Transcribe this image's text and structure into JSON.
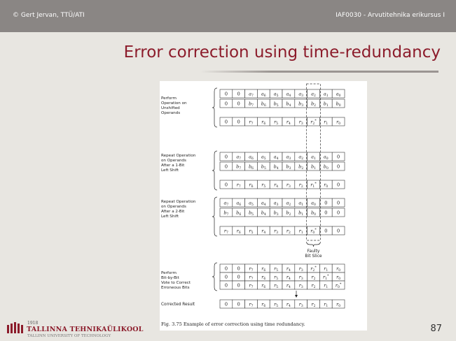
{
  "header": {
    "left": "© Gert Jervan, TTÜ/ATI",
    "right": "IAF0030 - Arvutitehnika erikursus I"
  },
  "slide": {
    "title": "Error correction using time-redundancy",
    "page_number": "87"
  },
  "logo": {
    "year": "1918",
    "name": "TALLINNA TEHNIKAÜLIKOOL",
    "sub": "TALLINN UNIVERSITY OF TECHNOLOGY"
  },
  "figure": {
    "caption": "Fig. 3.75 Example of error correction using time redundancy.",
    "faulty_label_1": "Faulty",
    "faulty_label_2": "Bit Slice",
    "groups": [
      {
        "label": [
          "Perform",
          "Operation on",
          "Unshifted",
          "Operands"
        ],
        "rows": [
          [
            "0",
            "0",
            "a7",
            "a6",
            "a5",
            "a4",
            "a3",
            "a2",
            "a1",
            "a0"
          ],
          [
            "0",
            "0",
            "b7",
            "b6",
            "b5",
            "b4",
            "b3",
            "b2",
            "b1",
            "b0"
          ],
          [
            "0",
            "0",
            "r7",
            "r6",
            "r5",
            "r4",
            "r3",
            "r2*",
            "r1",
            "r0"
          ]
        ]
      },
      {
        "label": [
          "Repeat Operation",
          "on Operands",
          "After a 1-Bit",
          "Left Shift"
        ],
        "rows": [
          [
            "0",
            "a7",
            "a6",
            "a5",
            "a4",
            "a3",
            "a2",
            "a1",
            "a0",
            "0"
          ],
          [
            "0",
            "b7",
            "b6",
            "b5",
            "b4",
            "b3",
            "b2",
            "b1",
            "b0",
            "0"
          ],
          [
            "0",
            "r7",
            "r6",
            "r5",
            "r4",
            "r3",
            "r2",
            "r1*",
            "r0",
            "0"
          ]
        ]
      },
      {
        "label": [
          "Repeat Operation",
          "on Operands",
          "After a 2-Bit",
          "Left Shift"
        ],
        "rows": [
          [
            "a7",
            "a6",
            "a5",
            "a4",
            "a3",
            "a2",
            "a1",
            "a0",
            "0",
            "0"
          ],
          [
            "b7",
            "b6",
            "b5",
            "b4",
            "b3",
            "b2",
            "b1",
            "b0",
            "0",
            "0"
          ],
          [
            "r7",
            "r6",
            "r5",
            "r4",
            "r3",
            "r2",
            "r1",
            "r0*",
            "0",
            "0"
          ]
        ]
      },
      {
        "label": [
          "Perform",
          "Bit-by-Bit",
          "Vote to Correct",
          "Erroneous Bits"
        ],
        "rows": [
          [
            "0",
            "0",
            "r7",
            "r6",
            "r5",
            "r4",
            "r3",
            "r2*",
            "r1",
            "r0"
          ],
          [
            "0",
            "0",
            "r7",
            "r6",
            "r5",
            "r4",
            "r3",
            "r2",
            "r1*",
            "r0"
          ],
          [
            "0",
            "0",
            "r7",
            "r6",
            "r5",
            "r4",
            "r3",
            "r2",
            "r1",
            "r0*"
          ]
        ]
      }
    ],
    "result": {
      "label": "Corrected Result",
      "row": [
        "0",
        "0",
        "r7",
        "r6",
        "r5",
        "r4",
        "r3",
        "r2",
        "r1",
        "r0"
      ]
    }
  }
}
